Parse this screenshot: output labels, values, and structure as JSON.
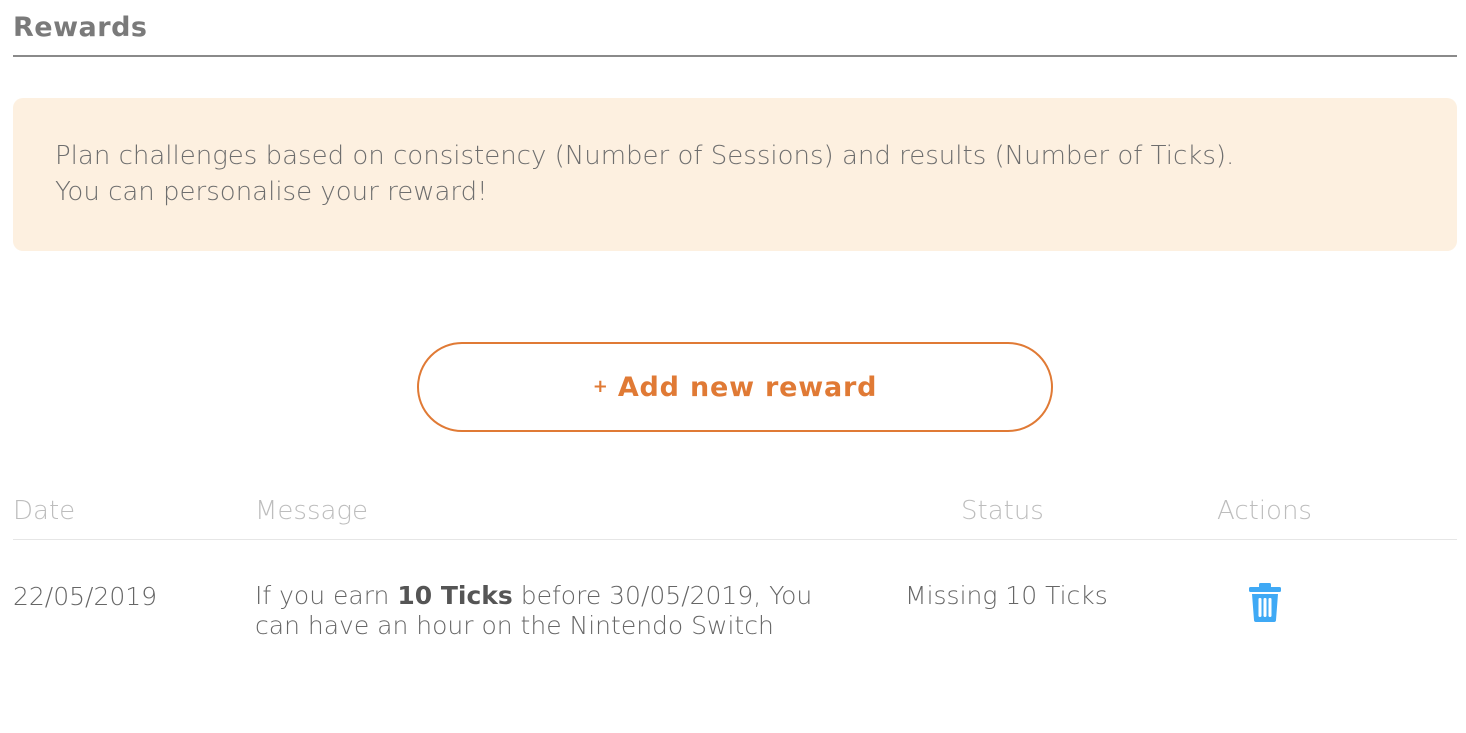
{
  "header": {
    "title": "Rewards"
  },
  "info": {
    "line1": "Plan challenges based on consistency (Number of Sessions) and results (Number of Ticks).",
    "line2": "You can personalise your reward!"
  },
  "add_button": {
    "icon": "plus-icon",
    "plus": "+",
    "label": "Add new reward"
  },
  "table": {
    "columns": [
      "Date",
      "Message",
      "Status",
      "Actions"
    ],
    "rows": [
      {
        "date": "22/05/2019",
        "message_pre": "If you earn ",
        "message_bold": "10 Ticks",
        "message_post": " before 30/05/2019, You can have an hour on the Nintendo Switch",
        "status": "Missing 10 Ticks",
        "action_icon": "trash-icon"
      }
    ]
  },
  "colors": {
    "accent": "#e07a35",
    "info_bg": "#fdf0e0",
    "trash": "#3fa9f5"
  }
}
